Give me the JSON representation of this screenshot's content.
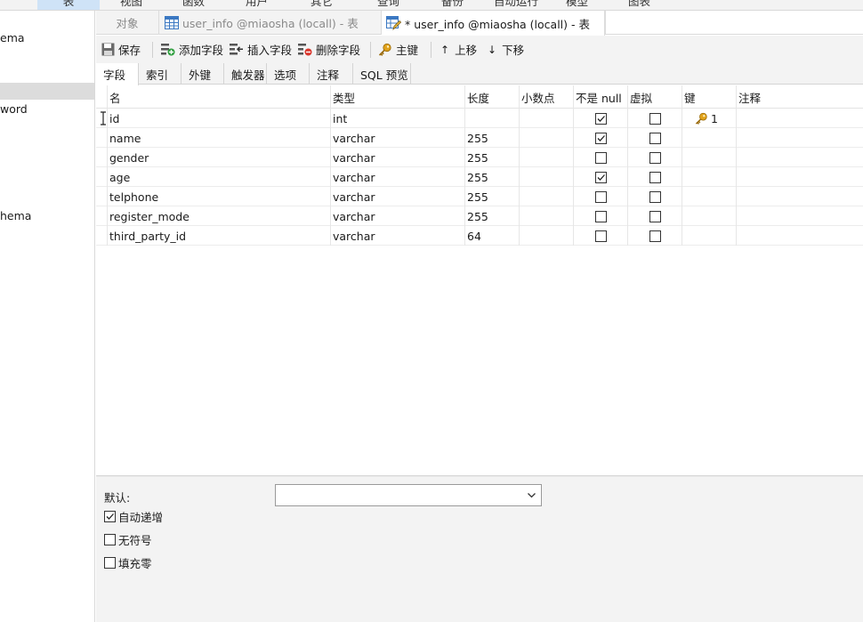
{
  "top_menu": [
    {
      "label": "表",
      "active": true
    },
    {
      "label": "视图"
    },
    {
      "label": "函数"
    },
    {
      "label": "用户"
    },
    {
      "label": "其它"
    },
    {
      "label": "查询"
    },
    {
      "label": "备份"
    },
    {
      "label": "自动运行"
    },
    {
      "label": "模型"
    },
    {
      "label": "图表"
    }
  ],
  "left_pane": {
    "items": [
      "ema",
      "word",
      "hema"
    ]
  },
  "tabs": {
    "objects": "对象",
    "tab1": "user_info @miaosha (locall) - 表",
    "tab2": "* user_info @miaosha (locall) - 表"
  },
  "toolbar": {
    "save": "保存",
    "add_field": "添加字段",
    "insert_field": "插入字段",
    "delete_field": "删除字段",
    "primary_key": "主键",
    "move_up": "上移",
    "move_down": "下移"
  },
  "sub_tabs": [
    "字段",
    "索引",
    "外键",
    "触发器",
    "选项",
    "注释",
    "SQL 预览"
  ],
  "columns": [
    "名",
    "类型",
    "长度",
    "小数点",
    "不是 null",
    "虚拟",
    "键",
    "注释"
  ],
  "rows": [
    {
      "name": "id",
      "type": "int",
      "length": "",
      "decimal": "",
      "not_null": true,
      "virtual": false,
      "key": "1"
    },
    {
      "name": "name",
      "type": "varchar",
      "length": "255",
      "decimal": "",
      "not_null": true,
      "virtual": false,
      "key": ""
    },
    {
      "name": "gender",
      "type": "varchar",
      "length": "255",
      "decimal": "",
      "not_null": false,
      "virtual": false,
      "key": ""
    },
    {
      "name": "age",
      "type": "varchar",
      "length": "255",
      "decimal": "",
      "not_null": true,
      "virtual": false,
      "key": ""
    },
    {
      "name": "telphone",
      "type": "varchar",
      "length": "255",
      "decimal": "",
      "not_null": false,
      "virtual": false,
      "key": ""
    },
    {
      "name": "register_mode",
      "type": "varchar",
      "length": "255",
      "decimal": "",
      "not_null": false,
      "virtual": false,
      "key": ""
    },
    {
      "name": "third_party_id",
      "type": "varchar",
      "length": "64",
      "decimal": "",
      "not_null": false,
      "virtual": false,
      "key": ""
    }
  ],
  "bottom": {
    "default_label": "默认:",
    "default_value": "",
    "auto_increment": {
      "label": "自动递增",
      "checked": true
    },
    "unsigned": {
      "label": "无符号",
      "checked": false
    },
    "zerofill": {
      "label": "填充零",
      "checked": false
    }
  },
  "colors": {
    "selection": "#cfe3f7",
    "key_icon": "#e0a21b"
  }
}
